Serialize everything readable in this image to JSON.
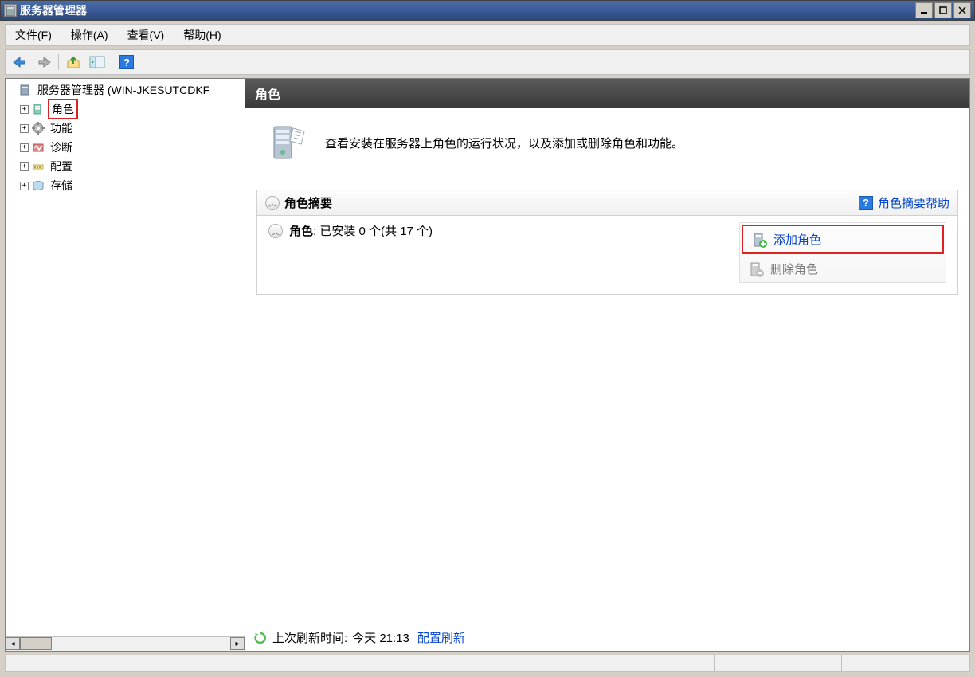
{
  "window": {
    "title": "服务器管理器"
  },
  "menu": {
    "file": "文件(F)",
    "action": "操作(A)",
    "view": "查看(V)",
    "help": "帮助(H)"
  },
  "tree": {
    "root": "服务器管理器 (WIN-JKESUTCDKF",
    "items": [
      {
        "label": "角色",
        "highlighted": true
      },
      {
        "label": "功能",
        "highlighted": false
      },
      {
        "label": "诊断",
        "highlighted": false
      },
      {
        "label": "配置",
        "highlighted": false
      },
      {
        "label": "存储",
        "highlighted": false
      }
    ]
  },
  "content": {
    "header": "角色",
    "banner_text": "查看安装在服务器上角色的运行状况，以及添加或删除角色和功能。",
    "summary": {
      "title": "角色摘要",
      "help_label": "角色摘要帮助",
      "role_label": "角色",
      "role_status": "已安装 0 个(共 17 个)",
      "action_add": "添加角色",
      "action_remove": "删除角色"
    },
    "refresh": {
      "label": "上次刷新时间:",
      "value": "今天 21:13",
      "configure": "配置刷新"
    }
  }
}
